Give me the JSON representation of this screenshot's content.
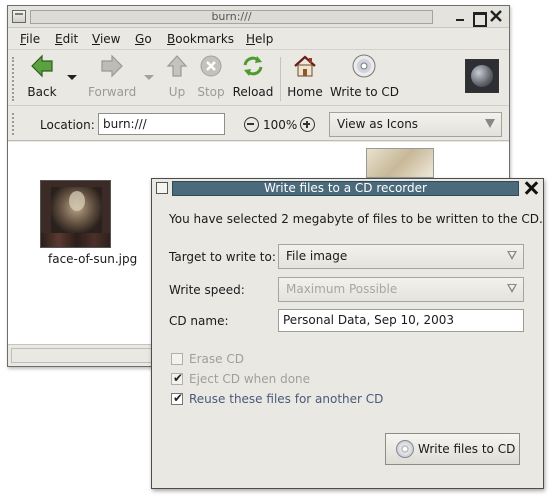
{
  "nautilus": {
    "title": "burn:///",
    "menu": [
      {
        "mnemonic": "F",
        "rest": "ile"
      },
      {
        "mnemonic": "E",
        "rest": "dit"
      },
      {
        "mnemonic": "V",
        "rest": "iew"
      },
      {
        "mnemonic": "G",
        "rest": "o"
      },
      {
        "mnemonic": "B",
        "rest": "ookmarks"
      },
      {
        "mnemonic": "H",
        "rest": "elp"
      }
    ],
    "toolbar": {
      "back": "Back",
      "forward": "Forward",
      "up": "Up",
      "stop": "Stop",
      "reload": "Reload",
      "home": "Home",
      "write_to_cd": "Write to CD"
    },
    "location": {
      "label": "Location:",
      "value": "burn:///",
      "zoom": "100%",
      "view_mode": "View as Icons"
    },
    "files": [
      {
        "name": "face-of-sun.jpg"
      }
    ]
  },
  "dialog": {
    "title": "Write files to a CD recorder",
    "message": "You have selected 2 megabyte of files to be written to the CD.",
    "target_label": "Target to write to:",
    "target_value": "File image",
    "speed_label": "Write speed:",
    "speed_value": "Maximum Possible",
    "cd_name_label": "CD name:",
    "cd_name_value": "Personal Data, Sep 10, 2003",
    "erase_label": "Erase CD",
    "erase_checked": false,
    "eject_label": "Eject CD when done",
    "eject_checked": true,
    "reuse_label": "Reuse these files for another CD",
    "reuse_checked": true,
    "write_button": "Write files to CD"
  },
  "colors": {
    "dialog_title_bar": "#4b6b7d",
    "window_bg": "#e9e8e3",
    "reuse_label": "#4a5a78"
  }
}
